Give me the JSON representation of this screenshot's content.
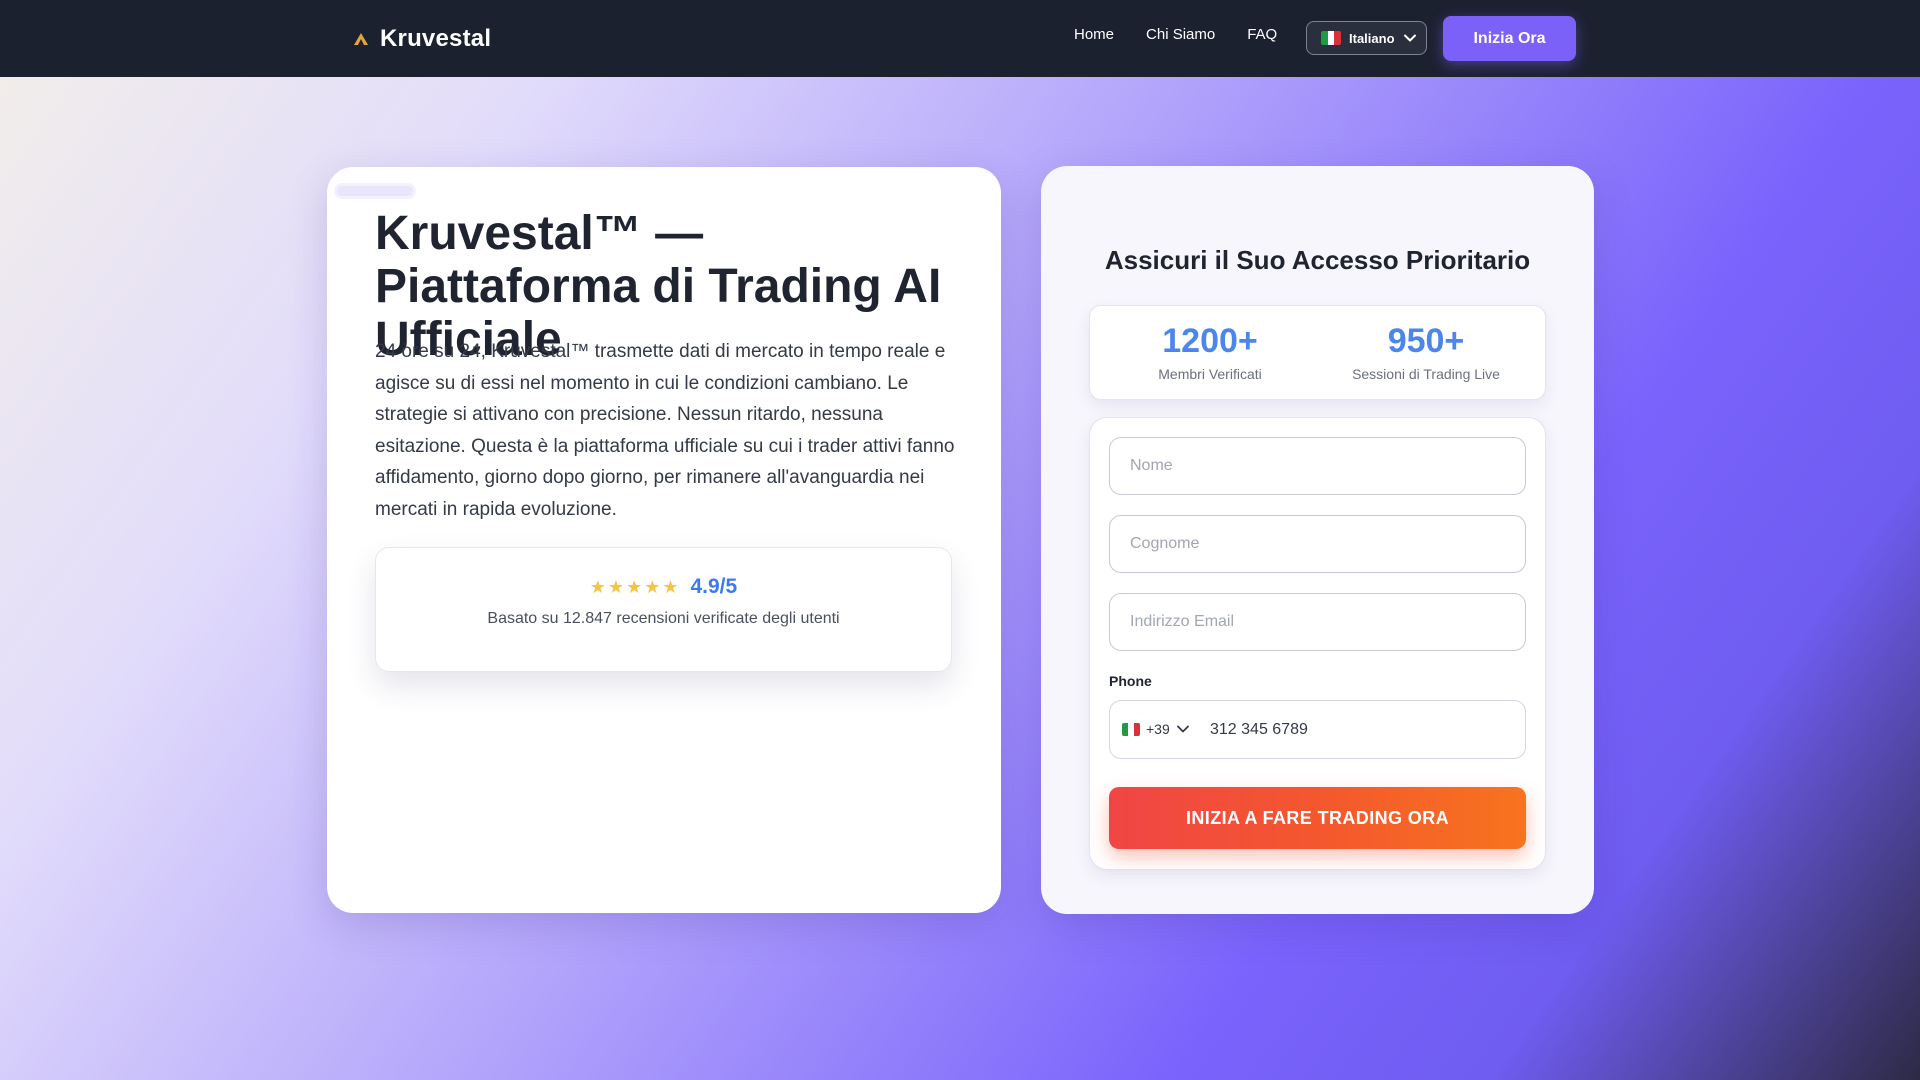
{
  "navbar": {
    "brand_name": "Kruvestal",
    "links": [
      {
        "label": "Home"
      },
      {
        "label": "Chi Siamo"
      },
      {
        "label": "FAQ"
      }
    ],
    "language": {
      "label": "Italiano",
      "flag_icon": "italy-flag-icon"
    },
    "cta_label": "Inizia Ora"
  },
  "hero": {
    "title": "Kruvestal™ — Piattaforma di Trading AI Ufficiale",
    "description": "24 ore su 24, Kruvestal™ trasmette dati di mercato in tempo reale e agisce su di essi nel momento in cui le condizioni cambiano. Le strategie si attivano con precisione. Nessun ritardo, nessuna esitazione. Questa è la piattaforma ufficiale su cui i trader attivi fanno affidamento, giorno dopo giorno, per rimanere all'avanguardia nei mercati in rapida evoluzione.",
    "rating": {
      "stars": "★★★★★",
      "score": "4.9/5",
      "subtitle": "Basato su 12.847 recensioni verificate degli utenti"
    }
  },
  "signup": {
    "title": "Assicuri il Suo Accesso Prioritario",
    "stats": [
      {
        "value": "1200+",
        "label": "Membri Verificati"
      },
      {
        "value": "950+",
        "label": "Sessioni di Trading Live"
      }
    ],
    "fields": {
      "first_name_placeholder": "Nome",
      "last_name_placeholder": "Cognome",
      "email_placeholder": "Indirizzo Email"
    },
    "phone": {
      "label": "Phone",
      "country_code": "+39",
      "value": "312 345 6789"
    },
    "submit_label": "INIZIA A FARE TRADING ORA"
  },
  "colors": {
    "navbar_bg": "#1c2130",
    "accent_purple": "#7b61f8",
    "stat_blue": "#4c86ea",
    "cta_red": "#f04545",
    "cta_orange": "#f7741e",
    "star_gold": "#f4c542"
  }
}
